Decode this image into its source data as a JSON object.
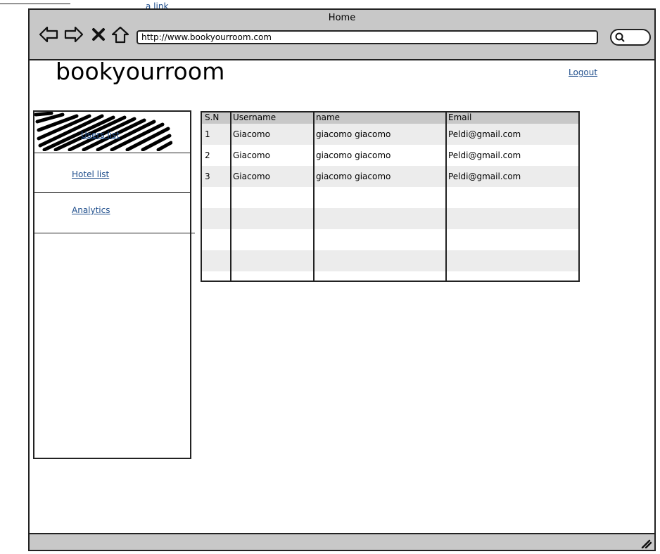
{
  "page": {
    "top_link": "a link"
  },
  "browser": {
    "title": "Home",
    "url": "http://www.bookyourroom.com",
    "icons": [
      "back-arrow-icon",
      "forward-arrow-icon",
      "close-icon",
      "home-icon",
      "search-icon"
    ]
  },
  "header": {
    "logo": "bookyourroom",
    "logout": "Logout"
  },
  "sidebar": {
    "items": [
      {
        "label": "Users list",
        "state": "active"
      },
      {
        "label": "Hotel list"
      },
      {
        "label": "Analytics"
      }
    ]
  },
  "table": {
    "columns": [
      "S.N",
      "Username",
      "name",
      "Email"
    ],
    "rows": [
      [
        "1",
        "Giacomo",
        "giacomo giacomo",
        "Peldi@gmail.com"
      ],
      [
        "2",
        "Giacomo",
        "giacomo giacomo",
        "Peldi@gmail.com"
      ],
      [
        "3",
        "Giacomo",
        "giacomo giacomo",
        "Peldi@gmail.com"
      ]
    ],
    "empty_rows": 4
  },
  "colors": {
    "chrome": "#c8c8c8",
    "stripe": "#ececec",
    "link": "#1f4e8c"
  }
}
